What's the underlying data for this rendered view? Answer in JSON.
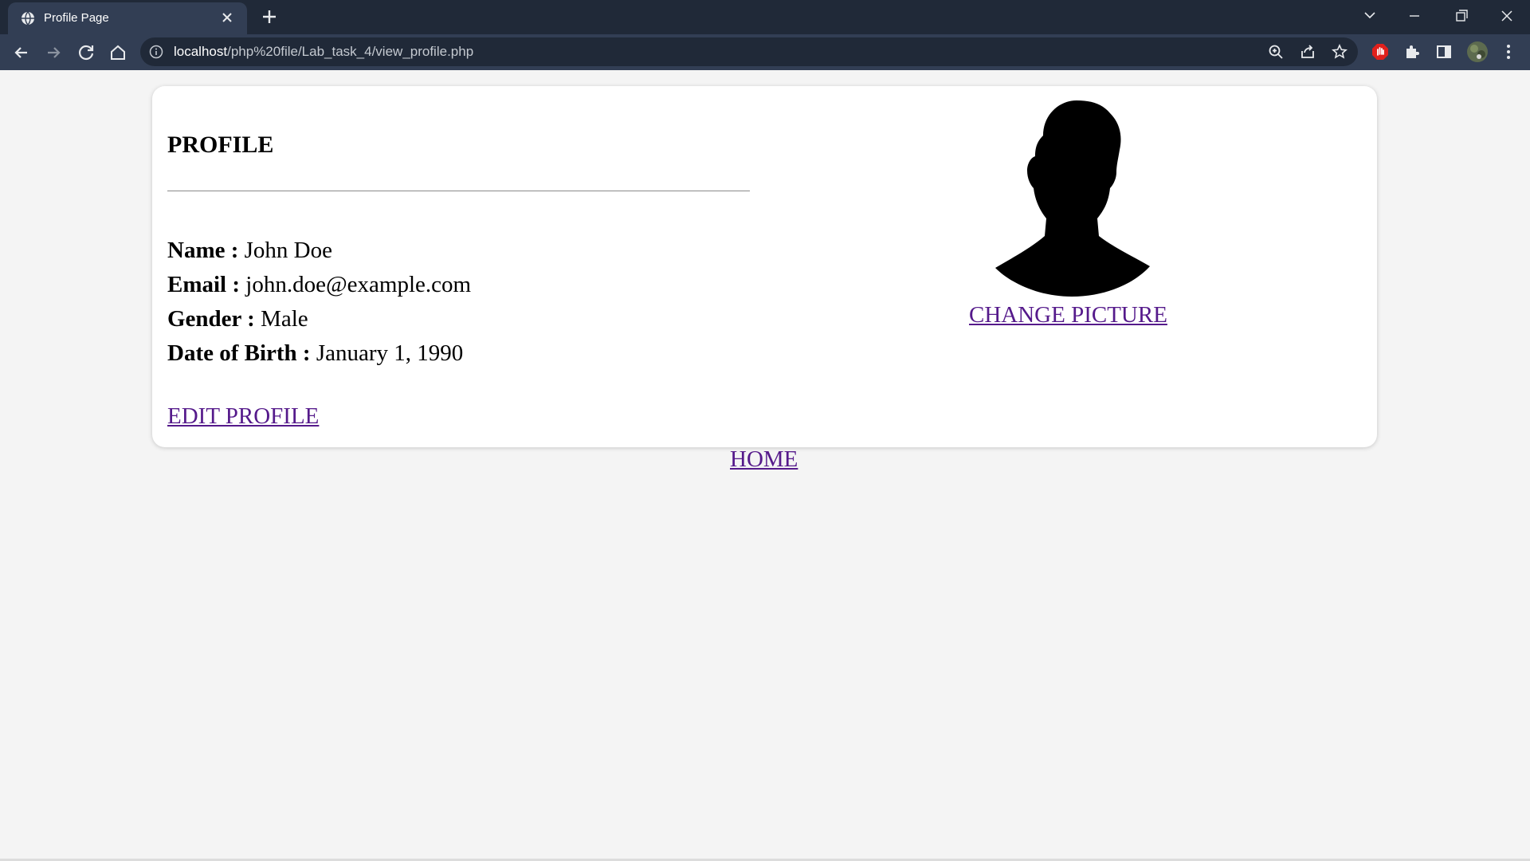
{
  "browser": {
    "tab_title": "Profile Page",
    "url_host": "localhost",
    "url_path": "/php%20file/Lab_task_4/view_profile.php"
  },
  "profile": {
    "heading": "PROFILE",
    "fields": [
      {
        "label": "Name :",
        "value": "John Doe"
      },
      {
        "label": "Email :",
        "value": "john.doe@example.com"
      },
      {
        "label": "Gender :",
        "value": "Male"
      },
      {
        "label": "Date of Birth :",
        "value": "January 1, 1990"
      }
    ],
    "edit_link": "EDIT PROFILE",
    "change_picture_link": "CHANGE PICTURE"
  },
  "nav": {
    "home_link": "HOME"
  },
  "colors": {
    "link": "#551a8b",
    "page_bg": "#f4f4f4",
    "card_bg": "#ffffff",
    "chrome_dark": "#202938",
    "chrome_toolbar": "#323e54"
  }
}
